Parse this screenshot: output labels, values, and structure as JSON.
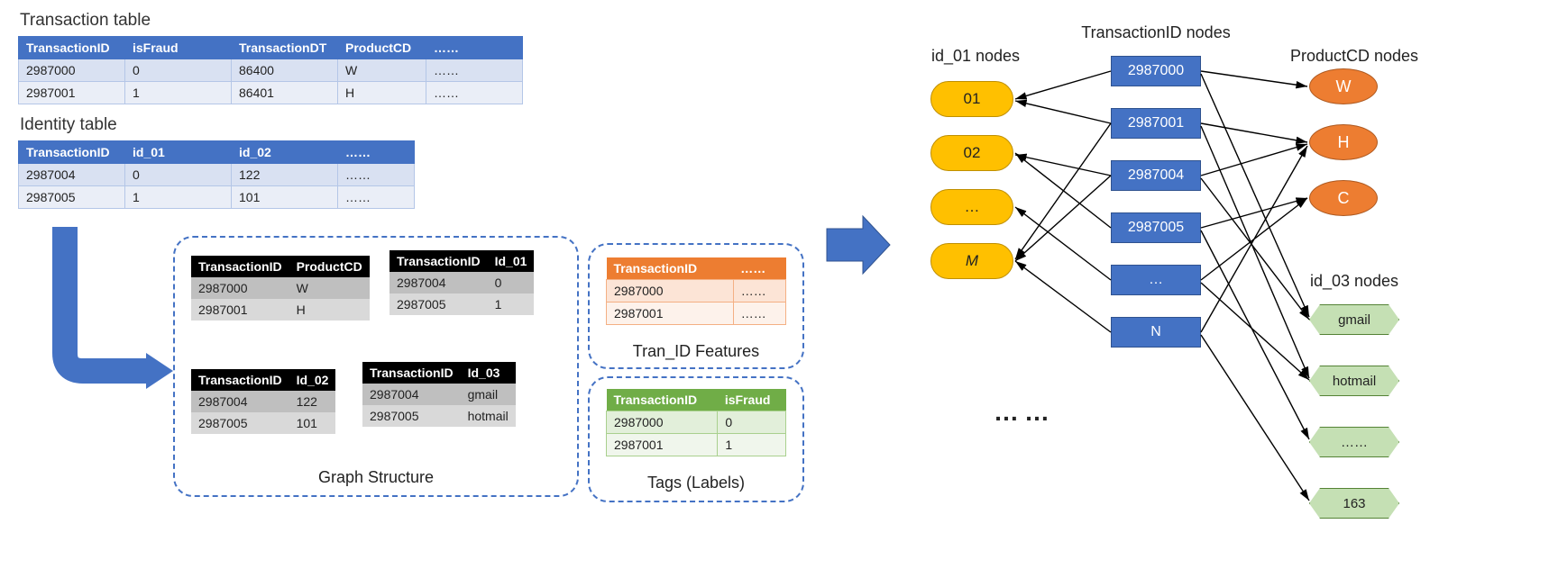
{
  "titles": {
    "transaction_table": "Transaction table",
    "identity_table": "Identity table"
  },
  "transaction_table": {
    "headers": [
      "TransactionID",
      "isFraud",
      "TransactionDT",
      "ProductCD",
      "……"
    ],
    "rows": [
      [
        "2987000",
        "0",
        "86400",
        "W",
        "……"
      ],
      [
        "2987001",
        "1",
        "86401",
        "H",
        "……"
      ]
    ]
  },
  "identity_table": {
    "headers": [
      "TransactionID",
      "id_01",
      "id_02",
      "……"
    ],
    "rows": [
      [
        "2987004",
        "0",
        "122",
        "……"
      ],
      [
        "2987005",
        "1",
        "101",
        "……"
      ]
    ]
  },
  "graph_structure": {
    "caption": "Graph Structure",
    "t_product": {
      "headers": [
        "TransactionID",
        "ProductCD"
      ],
      "rows": [
        [
          "2987000",
          "W"
        ],
        [
          "2987001",
          "H"
        ]
      ]
    },
    "t_id01": {
      "headers": [
        "TransactionID",
        "Id_01"
      ],
      "rows": [
        [
          "2987004",
          "0"
        ],
        [
          "2987005",
          "1"
        ]
      ]
    },
    "t_id02": {
      "headers": [
        "TransactionID",
        "Id_02"
      ],
      "rows": [
        [
          "2987004",
          "122"
        ],
        [
          "2987005",
          "101"
        ]
      ]
    },
    "t_id03": {
      "headers": [
        "TransactionID",
        "Id_03"
      ],
      "rows": [
        [
          "2987004",
          "gmail"
        ],
        [
          "2987005",
          "hotmail"
        ]
      ]
    }
  },
  "features": {
    "caption": "Tran_ID Features",
    "headers": [
      "TransactionID",
      "……"
    ],
    "rows": [
      [
        "2987000",
        "……"
      ],
      [
        "2987001",
        "……"
      ]
    ]
  },
  "tags": {
    "caption": "Tags (Labels)",
    "headers": [
      "TransactionID",
      "isFraud"
    ],
    "rows": [
      [
        "2987000",
        "0"
      ],
      [
        "2987001",
        "1"
      ]
    ]
  },
  "graph": {
    "label_id01": "id_01 nodes",
    "label_txn": "TransactionID nodes",
    "label_prod": "ProductCD nodes",
    "label_id03": "id_03 nodes",
    "id01_nodes": [
      "01",
      "02",
      "…",
      "M"
    ],
    "txn_nodes": [
      "2987000",
      "2987001",
      "2987004",
      "2987005",
      "…",
      "N"
    ],
    "prod_nodes": [
      "W",
      "H",
      "C"
    ],
    "id03_nodes": [
      "gmail",
      "hotmail",
      "……",
      "163"
    ],
    "ellipsis": "……"
  }
}
